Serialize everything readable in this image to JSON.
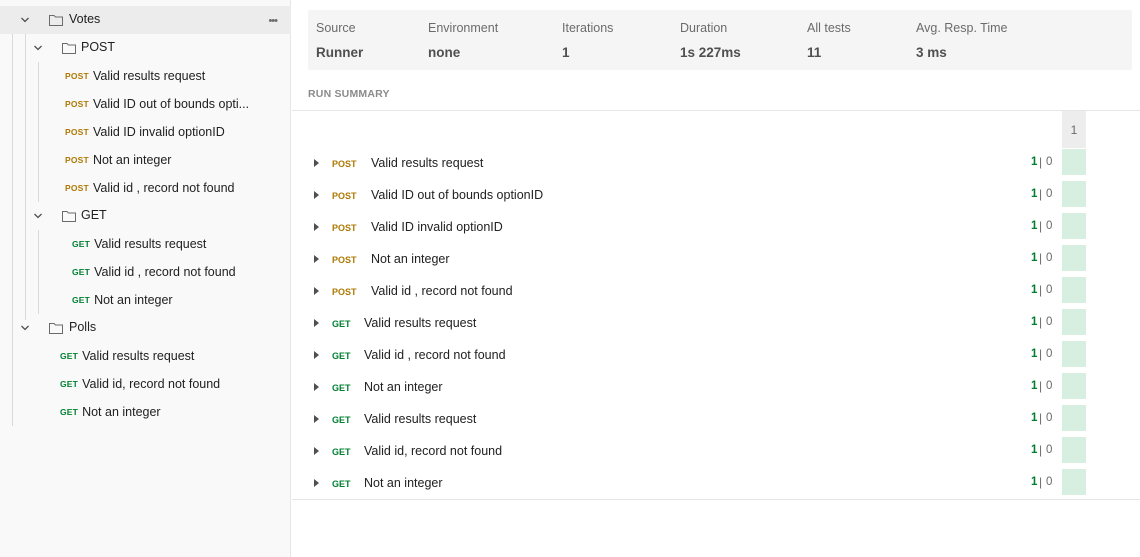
{
  "sidebar": {
    "collections": [
      {
        "name": "Votes",
        "more": "•••",
        "folders": [
          {
            "name": "POST",
            "requests": [
              {
                "method": "POST",
                "name": "Valid results request"
              },
              {
                "method": "POST",
                "name": "Valid ID out of bounds opti..."
              },
              {
                "method": "POST",
                "name": "Valid ID invalid optionID"
              },
              {
                "method": "POST",
                "name": "Not an integer"
              },
              {
                "method": "POST",
                "name": "Valid id , record not found"
              }
            ]
          },
          {
            "name": "GET",
            "requests": [
              {
                "method": "GET",
                "name": "Valid results request"
              },
              {
                "method": "GET",
                "name": "Valid id , record not found"
              },
              {
                "method": "GET",
                "name": "Not an integer"
              }
            ]
          }
        ]
      },
      {
        "name": "Polls",
        "requests": [
          {
            "method": "GET",
            "name": "Valid results request"
          },
          {
            "method": "GET",
            "name": "Valid id, record not found"
          },
          {
            "method": "GET",
            "name": "Not an integer"
          }
        ]
      }
    ]
  },
  "stats": [
    {
      "label": "Source",
      "value": "Runner"
    },
    {
      "label": "Environment",
      "value": "none"
    },
    {
      "label": "Iterations",
      "value": "1"
    },
    {
      "label": "Duration",
      "value": "1s 227ms"
    },
    {
      "label": "All tests",
      "value": "11"
    },
    {
      "label": "Avg. Resp. Time",
      "value": "3 ms"
    }
  ],
  "run_summary": {
    "title": "RUN SUMMARY",
    "iteration_header": "1",
    "separator": "|",
    "results": [
      {
        "method": "POST",
        "name": "Valid results request",
        "passed": "1",
        "failed": "0"
      },
      {
        "method": "POST",
        "name": "Valid ID out of bounds optionID",
        "passed": "1",
        "failed": "0"
      },
      {
        "method": "POST",
        "name": "Valid ID invalid optionID",
        "passed": "1",
        "failed": "0"
      },
      {
        "method": "POST",
        "name": "Not an integer",
        "passed": "1",
        "failed": "0"
      },
      {
        "method": "POST",
        "name": "Valid id , record not found",
        "passed": "1",
        "failed": "0"
      },
      {
        "method": "GET",
        "name": "Valid results request",
        "passed": "1",
        "failed": "0"
      },
      {
        "method": "GET",
        "name": "Valid id , record not found",
        "passed": "1",
        "failed": "0"
      },
      {
        "method": "GET",
        "name": "Not an integer",
        "passed": "1",
        "failed": "0"
      },
      {
        "method": "GET",
        "name": "Valid results request",
        "passed": "1",
        "failed": "0"
      },
      {
        "method": "GET",
        "name": "Valid id, record not found",
        "passed": "1",
        "failed": "0"
      },
      {
        "method": "GET",
        "name": "Not an integer",
        "passed": "1",
        "failed": "0"
      }
    ]
  },
  "colors": {
    "post": "#ad7a03",
    "get": "#007f31",
    "pass_cell": "#d7efe0"
  }
}
